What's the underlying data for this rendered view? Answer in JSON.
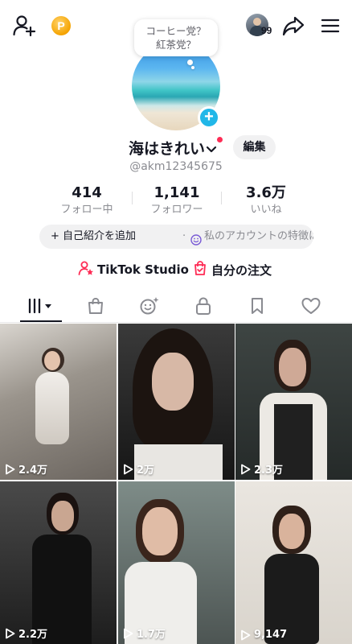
{
  "header": {
    "icons": [
      "add-user-icon",
      "coin-icon",
      "share-icon",
      "menu-icon"
    ],
    "coin_symbol": "P",
    "notification_badge": "99"
  },
  "profile": {
    "bubble_line1": "コーヒー党？",
    "bubble_line2": "紅茶党？",
    "name": "海はきれい",
    "edit_label": "編集",
    "handle": "@akm12345675"
  },
  "stats": [
    {
      "value": "414",
      "label": "フォロー中"
    },
    {
      "value": "1,141",
      "label": "フォロワー"
    },
    {
      "value": "3.6万",
      "label": "いいね"
    }
  ],
  "bio": {
    "add_label": "自己紹介を追加",
    "separator": "·",
    "hint": "私のアカウントの特徴は..."
  },
  "links": {
    "studio": "TikTok Studio",
    "orders": "自分の注文"
  },
  "tabs": [
    "videos-grid",
    "shop",
    "favorites-faces",
    "private-lock",
    "bookmarks",
    "likes"
  ],
  "videos": [
    {
      "views": "2.4万"
    },
    {
      "views": "2万"
    },
    {
      "views": "2.3万"
    },
    {
      "views": "2.2万"
    },
    {
      "views": "1.7万"
    },
    {
      "views": "9,147"
    }
  ],
  "colors": {
    "accent_red": "#fe2c55",
    "avatar_plus": "#21b7e8",
    "text_primary": "#161823",
    "text_secondary": "#8a8b91"
  }
}
